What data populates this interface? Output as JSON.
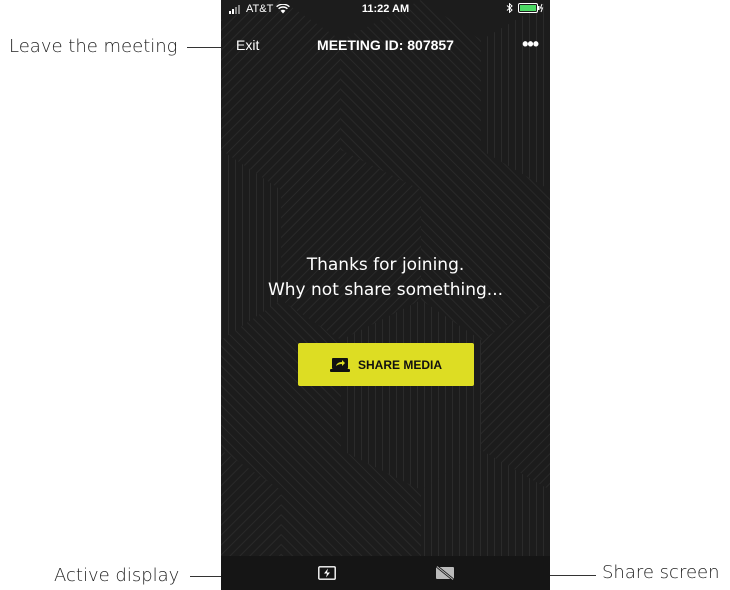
{
  "callouts": {
    "leave": "Leave the meeting",
    "active_display": "Active display",
    "share_screen": "Share screen"
  },
  "status_bar": {
    "carrier": "AT&T",
    "time": "11:22 AM"
  },
  "nav": {
    "exit_label": "Exit",
    "meeting_id": "MEETING ID: 807857",
    "more_label": "•••"
  },
  "main": {
    "line1": "Thanks for joining.",
    "line2": "Why not share something...",
    "share_button_label": "SHARE MEDIA"
  },
  "bottom_bar": {
    "items": [
      {
        "icon": "active-display-icon"
      },
      {
        "icon": "share-screen-off-icon"
      }
    ]
  },
  "colors": {
    "background": "#1c1c1c",
    "accent": "#dddd23",
    "bottom_bar": "#151515"
  }
}
